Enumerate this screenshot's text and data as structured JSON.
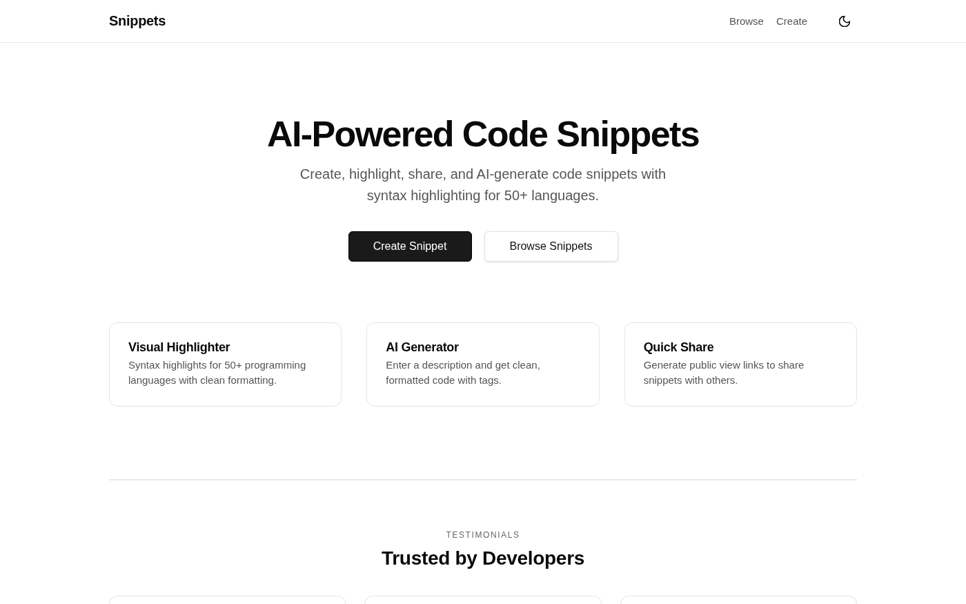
{
  "header": {
    "logo": "Snippets",
    "nav": [
      {
        "label": "Browse"
      },
      {
        "label": "Create"
      }
    ]
  },
  "hero": {
    "title": "AI-Powered Code Snippets",
    "subtitle": "Create, highlight, share, and AI-generate code snippets with syntax highlighting for 50+ languages.",
    "buttons": [
      {
        "label": "Create Snippet",
        "kind": "primary"
      },
      {
        "label": "Browse Snippets",
        "kind": "secondary"
      }
    ]
  },
  "features": [
    {
      "title": "Visual Highlighter",
      "description": "Syntax highlights for 50+ programming languages with clean formatting."
    },
    {
      "title": "AI Generator",
      "description": "Enter a description and get clean, formatted code with tags."
    },
    {
      "title": "Quick Share",
      "description": "Generate public view links to share snippets with others."
    }
  ],
  "testimonials": {
    "eyebrow": "TESTIMONIALS",
    "title": "Trusted by Developers"
  }
}
